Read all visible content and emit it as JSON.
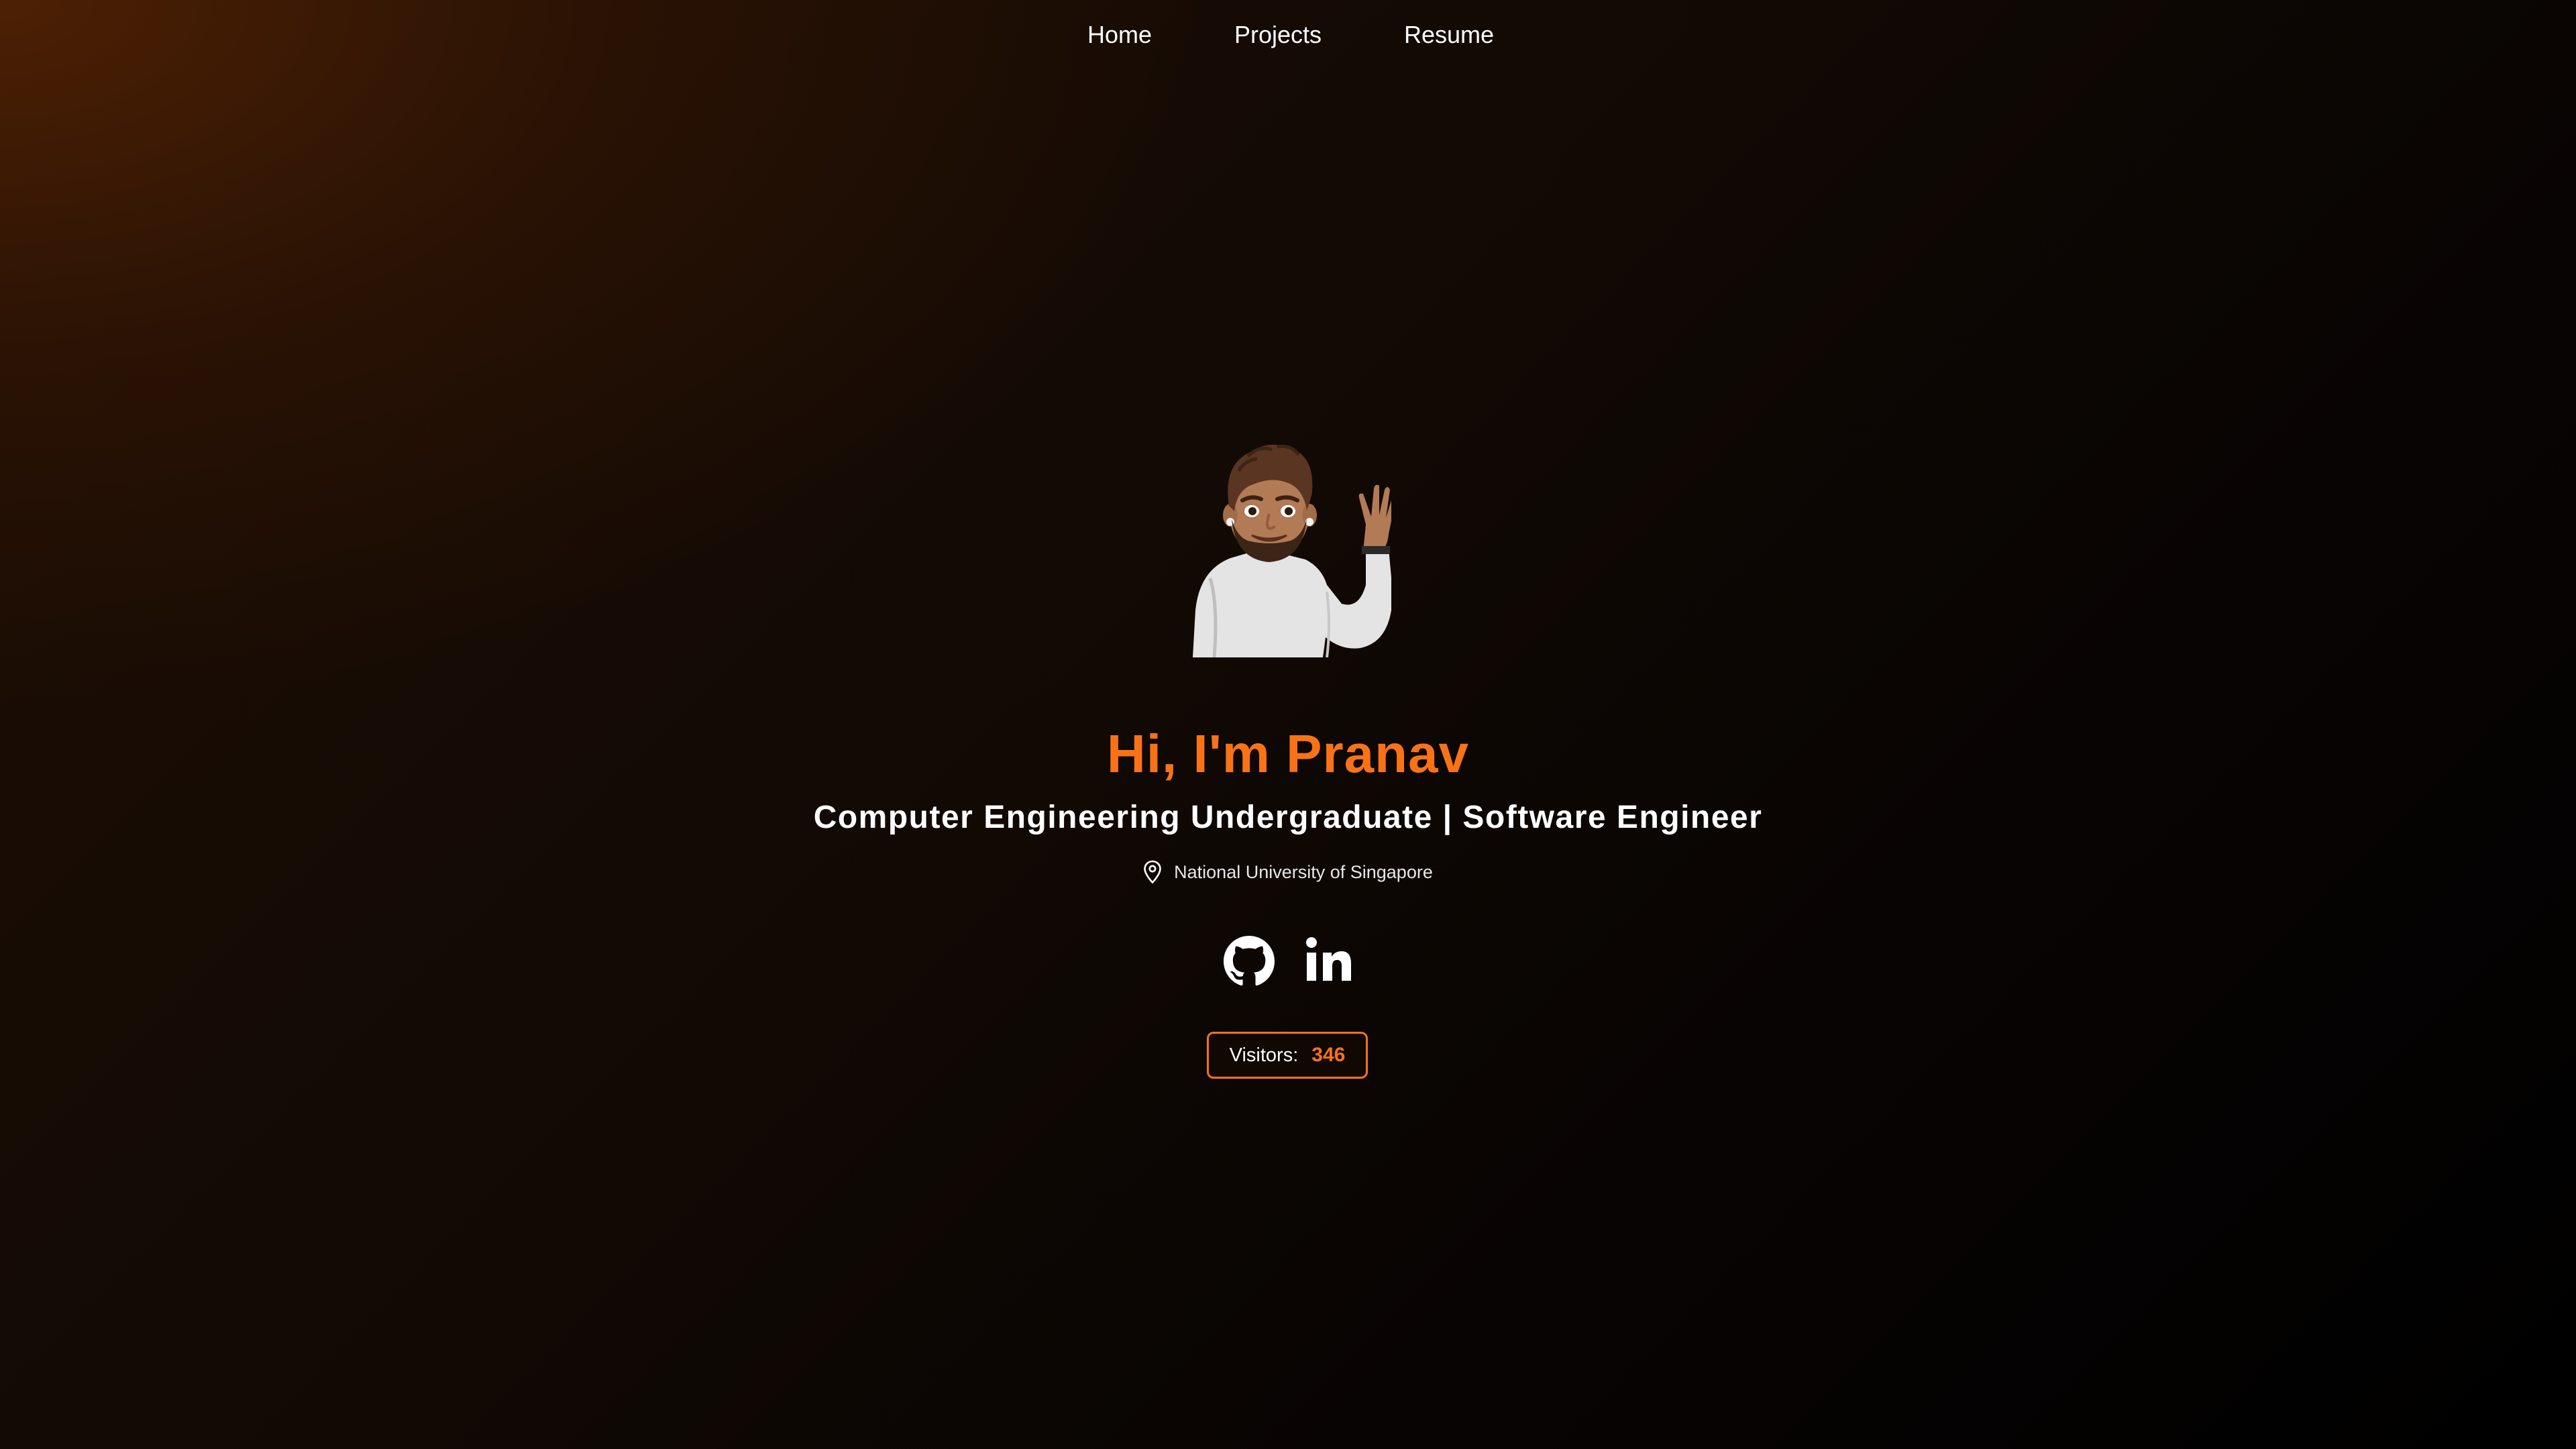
{
  "nav": {
    "items": [
      {
        "label": "Home"
      },
      {
        "label": "Projects"
      },
      {
        "label": "Resume"
      }
    ]
  },
  "hero": {
    "avatar_icon": "waving-memoji-avatar",
    "title": "Hi, I'm Pranav",
    "subtitle": "Computer Engineering Undergraduate | Software Engineer",
    "location": "National University of Singapore",
    "location_icon": "map-pin-icon"
  },
  "socials": [
    {
      "icon": "github-icon"
    },
    {
      "icon": "linkedin-icon"
    }
  ],
  "visitors": {
    "label": "Visitors:",
    "count": "346"
  },
  "colors": {
    "accent": "#f97316",
    "text": "#ffffff",
    "background_dark": "#000000",
    "background_glow": "#5c2604"
  }
}
